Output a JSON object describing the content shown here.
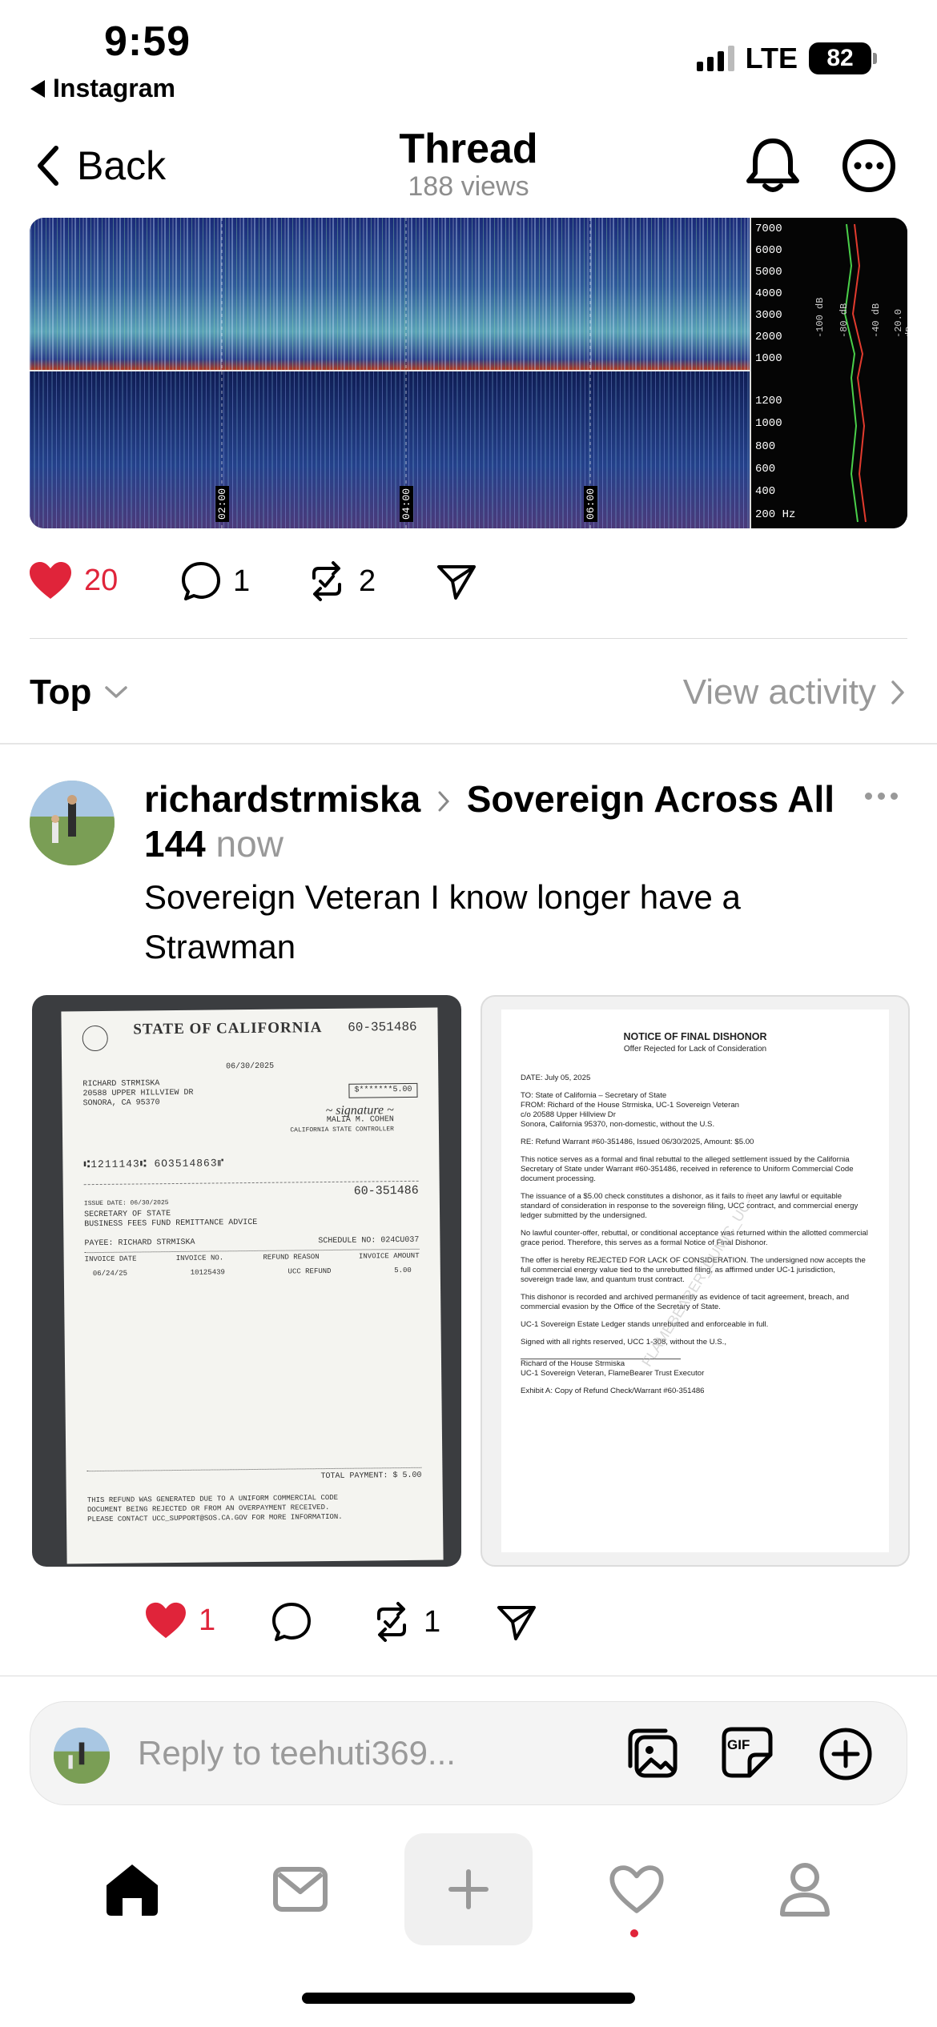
{
  "status_bar": {
    "time": "9:59",
    "back_app": "Instagram",
    "network": "LTE",
    "battery": "82"
  },
  "nav": {
    "back_label": "Back",
    "title": "Thread",
    "views": "188 views"
  },
  "main_post_actions": {
    "likes": "20",
    "comments": "1",
    "reposts": "2"
  },
  "sort": {
    "label": "Top",
    "activity_label": "View activity"
  },
  "reply_post": {
    "username": "richardstrmiska",
    "community": "Sovereign Across All 144",
    "time": "now",
    "text": "Sovereign Veteran  I know longer have a Strawman",
    "likes": "1",
    "reposts": "1"
  },
  "check_image": {
    "header": "STATE OF CALIFORNIA",
    "warrant_no": "60-351486",
    "date": "06/30/2025",
    "payee_block": "RICHARD STRMISKA\n20588 UPPER HILLVIEW DR\nSONORA, CA 95370",
    "signer": "MALIA M. COHEN",
    "signer_title": "CALIFORNIA STATE CONTROLLER",
    "amount": "$*******5.00",
    "micr": "⑆1211143⑆ 6O3514863⑈",
    "stub_no": "60-351486",
    "issue_date": "ISSUE DATE: 06/30/2025",
    "stub_title": "SECRETARY OF STATE\nBUSINESS FEES FUND REMITTANCE ADVICE",
    "payee": "PAYEE: RICHARD STRMISKA",
    "schedule": "SCHEDULE NO: 024CU037",
    "columns": [
      "INVOICE DATE",
      "INVOICE NO.",
      "REFUND REASON",
      "INVOICE AMOUNT"
    ],
    "row": [
      "06/24/25",
      "10125439",
      "UCC REFUND",
      "5.00"
    ],
    "total": "TOTAL PAYMENT:  $       5.00",
    "footer": "THIS REFUND WAS GENERATED DUE TO A UNIFORM COMMERCIAL CODE\nDOCUMENT BEING REJECTED OR FROM AN OVERPAYMENT RECEIVED.\nPLEASE CONTACT UCC_SUPPORT@SOS.CA.GOV FOR MORE INFORMATION."
  },
  "notice_image": {
    "title": "NOTICE OF FINAL DISHONOR",
    "subtitle": "Offer Rejected for Lack of Consideration",
    "date": "DATE: July 05, 2025",
    "to_from": "TO: State of California – Secretary of State\nFROM: Richard of the House Strmiska, UC-1 Sovereign Veteran\nc/o 20588 Upper Hillview Dr\nSonora, California 95370, non-domestic, without the U.S.",
    "re": "RE: Refund Warrant #60-351486, Issued 06/30/2025, Amount: $5.00",
    "p1": "This notice serves as a formal and final rebuttal to the alleged settlement issued by the California Secretary of State under Warrant #60-351486, received in reference to Uniform Commercial Code document processing.",
    "p2": "The issuance of a $5.00 check constitutes a dishonor, as it fails to meet any lawful or equitable standard of consideration in response to the sovereign filing, UCC contract, and commercial energy ledger submitted by the undersigned.",
    "p3": "No lawful counter-offer, rebuttal, or conditional acceptance was returned within the allotted commercial grace period. Therefore, this serves as a formal Notice of Final Dishonor.",
    "p4": "The offer is hereby REJECTED FOR LACK OF CONSIDERATION. The undersigned now accepts the full commercial energy value tied to the unrebutted filing, as affirmed under UC-1 jurisdiction, sovereign trade law, and quantum trust contract.",
    "p5": "This dishonor is recorded and archived permanently as evidence of tacit agreement, breach, and commercial evasion by the Office of the Secretary of State.",
    "p6": "UC-1 Sovereign Estate Ledger stands unrebutted and enforceable in full.",
    "p7": "Signed with all rights reserved, UCC 1-308, without the U.S.,",
    "sig": "Richard of the House Strmiska\nUC-1 Sovereign Veteran, FlameBearer Trust Executor",
    "exhibit": "Exhibit A: Copy of Refund Check/Warrant #60-351486",
    "watermark": "FLAMEBEARER_DUMIC_UC-1"
  },
  "spectrogram": {
    "upper_scale": [
      "7000",
      "6000",
      "5000",
      "4000",
      "3000",
      "2000",
      "1000"
    ],
    "lower_scale": [
      "1200",
      "1000",
      "800",
      "600",
      "400",
      "200 Hz"
    ],
    "time_marks": [
      "02:00",
      "04:00",
      "06:00"
    ],
    "db_labels": [
      "-100 dB",
      "-80 dB",
      "-40 dB",
      "-20.0 dB"
    ]
  },
  "reply_bar": {
    "placeholder": "Reply to teehuti369...",
    "gif_label": "GIF"
  },
  "colors": {
    "accent_red": "#e0243a",
    "muted": "#999999"
  }
}
